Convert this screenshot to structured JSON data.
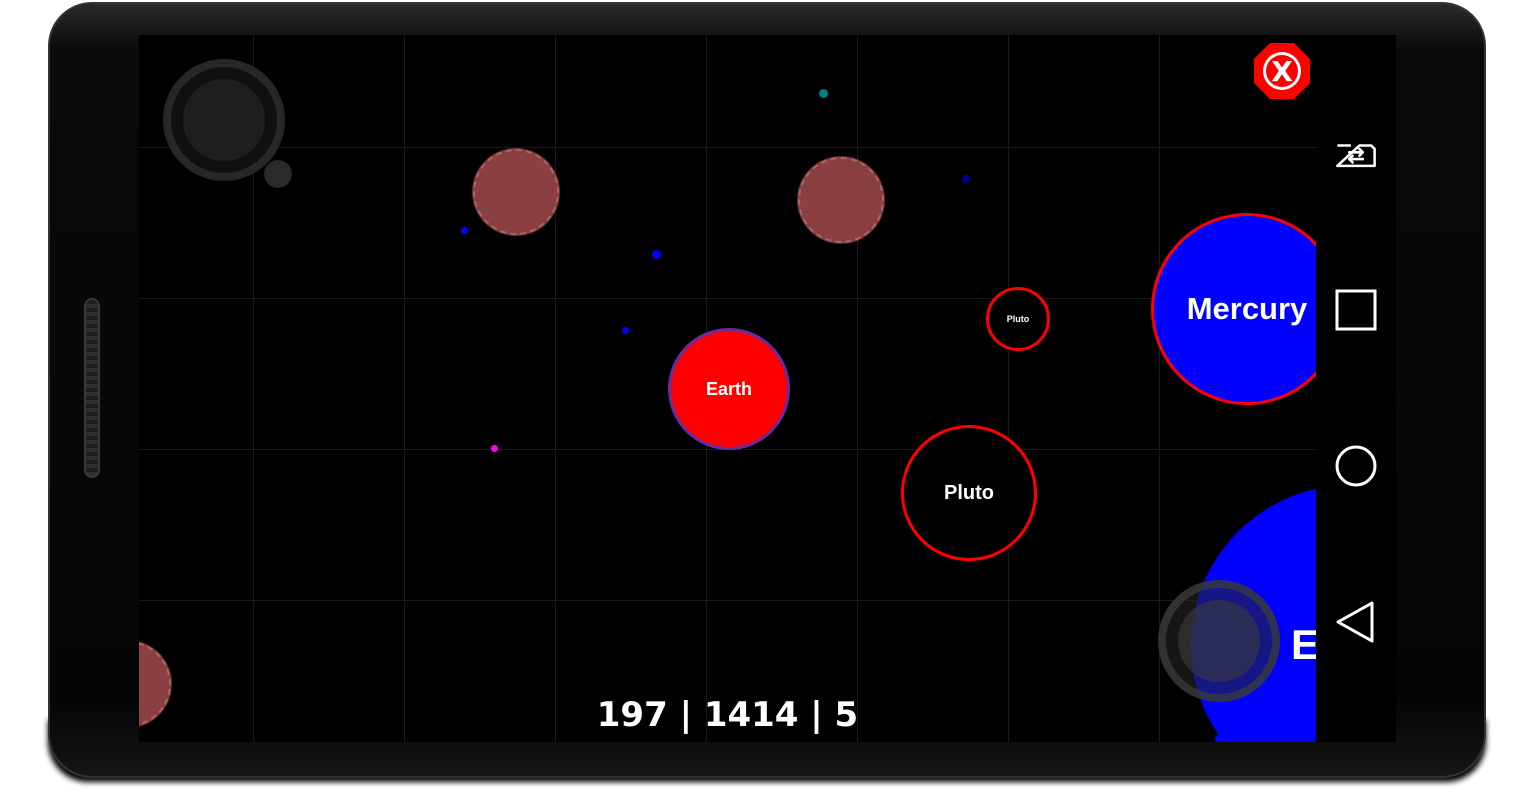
{
  "game": {
    "score_text": "197 | 1414 | 5",
    "cells": {
      "earth": {
        "label": "Earth",
        "color": "#ff0000",
        "border": "#6a2aa0"
      },
      "pluto_small": {
        "label": "Pluto",
        "border": "#ff0000"
      },
      "pluto": {
        "label": "Pluto",
        "border": "#ff0000"
      },
      "mercury": {
        "label": "Mercury",
        "color": "#0000ff",
        "border": "#ff0000"
      },
      "big_blue": {
        "label": "E",
        "color": "#0000ff"
      }
    },
    "colors": {
      "virus": "#8a4040",
      "background": "#000000",
      "grid": "#1a1a1a"
    }
  },
  "controls": {
    "close_icon": "close-x-icon",
    "close_label": "X",
    "close_color": "#ff0000"
  },
  "navbar": {
    "icons": [
      "rotate-screen-icon",
      "recents-square-icon",
      "home-circle-icon",
      "back-triangle-icon"
    ]
  }
}
